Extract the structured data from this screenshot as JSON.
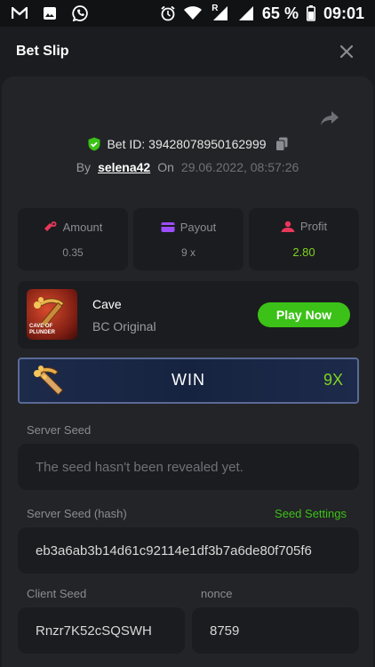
{
  "status_bar": {
    "battery": "65 %",
    "time": "09:01",
    "icons": [
      "gmail-icon",
      "gallery-icon",
      "viber-icon",
      "alarm-icon",
      "wifi-icon",
      "roaming-signal-icon",
      "signal-icon",
      "battery-icon"
    ],
    "roaming": "R"
  },
  "header": {
    "title": "Bet Slip"
  },
  "bet": {
    "id_label": "Bet ID: 39428078950162999",
    "by_label": "By",
    "user": "selena42",
    "on_label": "On",
    "date": "29.06.2022, 08:57:26"
  },
  "stats": [
    {
      "label": "Amount",
      "value": "0.35",
      "icon": "coins-icon"
    },
    {
      "label": "Payout",
      "value": "9 x",
      "icon": "wallet-icon"
    },
    {
      "label": "Profit",
      "value": "2.80",
      "icon": "profit-icon",
      "value_color": "#7ed321"
    }
  ],
  "game": {
    "thumb_text": "CAVE OF PLUNDER",
    "name": "Cave",
    "provider": "BC Original",
    "play_label": "Play Now"
  },
  "result": {
    "label": "WIN",
    "multiplier": "9X"
  },
  "seeds": {
    "server_seed_label": "Server Seed",
    "server_seed_value": "The seed hasn't been revealed yet.",
    "server_hash_label": "Server Seed (hash)",
    "seed_settings_label": "Seed Settings",
    "server_hash_value": "eb3a6ab3b14d61c92114e1df3b7a6de80f705f6",
    "client_seed_label": "Client Seed",
    "client_seed_value": "Rnzr7K52cSQSWH",
    "nonce_label": "nonce",
    "nonce_value": "8759"
  },
  "colors": {
    "accent_green": "#3bc117",
    "profit_green": "#7ed321",
    "background": "#1b1c1f",
    "panel": "#232427"
  }
}
